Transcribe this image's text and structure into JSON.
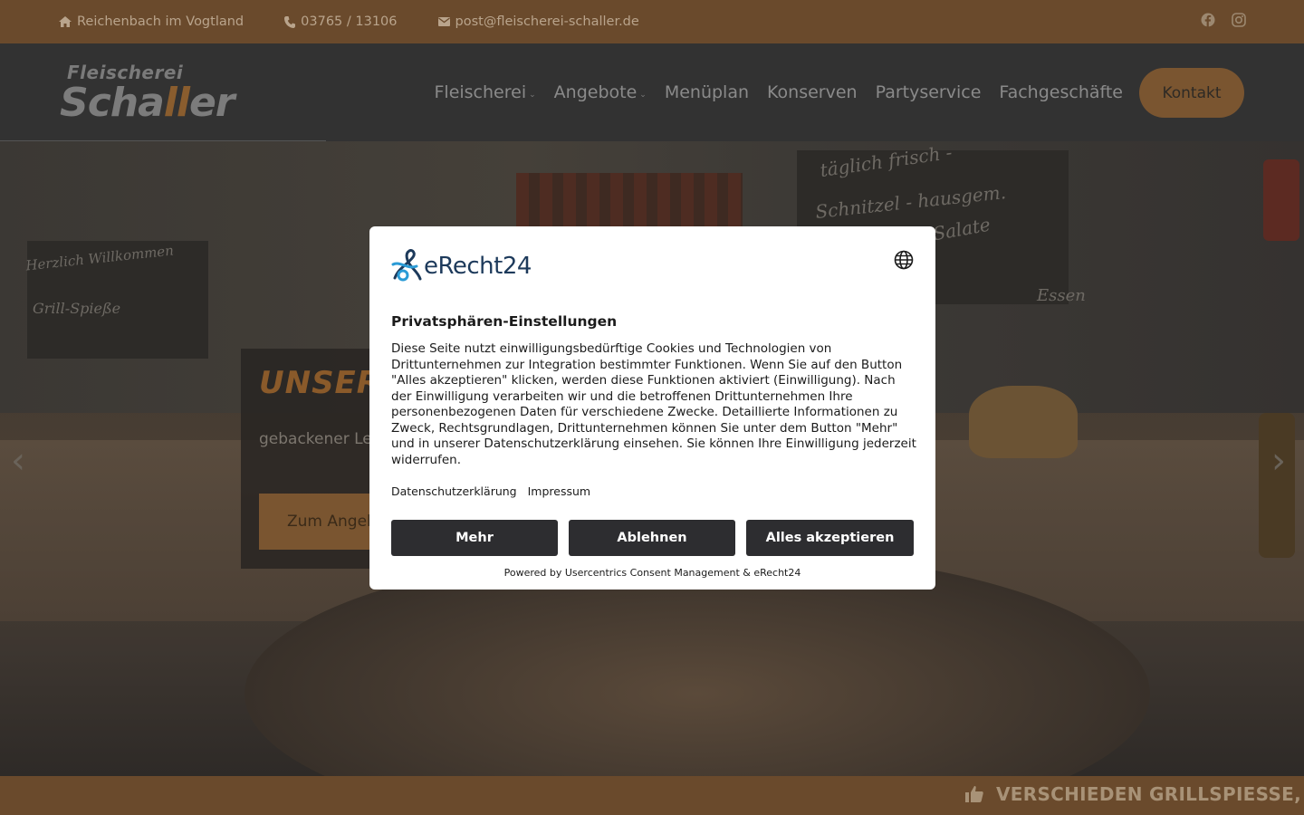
{
  "topbar": {
    "location": "Reichenbach im Vogtland",
    "phone": "03765 / 13106",
    "email": "post@fleischerei-schaller.de",
    "social": [
      "facebook-icon",
      "instagram-icon"
    ]
  },
  "header": {
    "logo_top": "Fleischerei",
    "logo_main_a": "Scha",
    "logo_main_accent": "ll",
    "logo_main_b": "er",
    "nav": [
      {
        "label": "Fleischerei",
        "dropdown": true
      },
      {
        "label": "Angebote",
        "dropdown": true
      },
      {
        "label": "Menüplan",
        "dropdown": false
      },
      {
        "label": "Konserven",
        "dropdown": false
      },
      {
        "label": "Partyservice",
        "dropdown": false
      },
      {
        "label": "Fachgeschäfte",
        "dropdown": false
      }
    ],
    "contact_label": "Kontakt"
  },
  "hero": {
    "title": "UNSER",
    "text": "gebackener Le",
    "button_label": "Zum Angel",
    "chalk": [
      "täglich frisch -",
      "Schnitzel - hausgem.",
      "Salate",
      "Herzlich Willkommen",
      "Grill-Spieße",
      "Essen"
    ]
  },
  "ticker": {
    "text": "VERSCHIEDEN GRILLSPIESSE, \\"
  },
  "consent": {
    "brand": "eRecht24",
    "title": "Privatsphären-Einstellungen",
    "description": "Diese Seite nutzt einwilligungsbedürftige Cookies und Technologien von Drittunternehmen zur Integration bestimmter Funktionen. Wenn Sie auf den Button \"Alles akzeptieren\" klicken, werden diese Funktionen aktiviert (Einwilligung). Nach der Einwilligung verarbeiten wir und die betroffenen Drittunternehmen Ihre personenbezogenen Daten für verschiedene Zwecke. Detaillierte Informationen zu Zweck, Rechtsgrundlagen, Drittunternehmen können Sie unter dem Button \"Mehr\" und in unserer Datenschutzerklärung einsehen. Sie können Ihre Einwilligung jederzeit widerrufen.",
    "link_privacy": "Datenschutzerklärung",
    "link_imprint": "Impressum",
    "btn_more": "Mehr",
    "btn_decline": "Ablehnen",
    "btn_accept": "Alles akzeptieren",
    "powered": "Powered by Usercentrics Consent Management & eRecht24"
  },
  "colors": {
    "brand_brown": "#6a4a2c",
    "accent": "#7a5530",
    "modal_button": "#2d2d30"
  }
}
